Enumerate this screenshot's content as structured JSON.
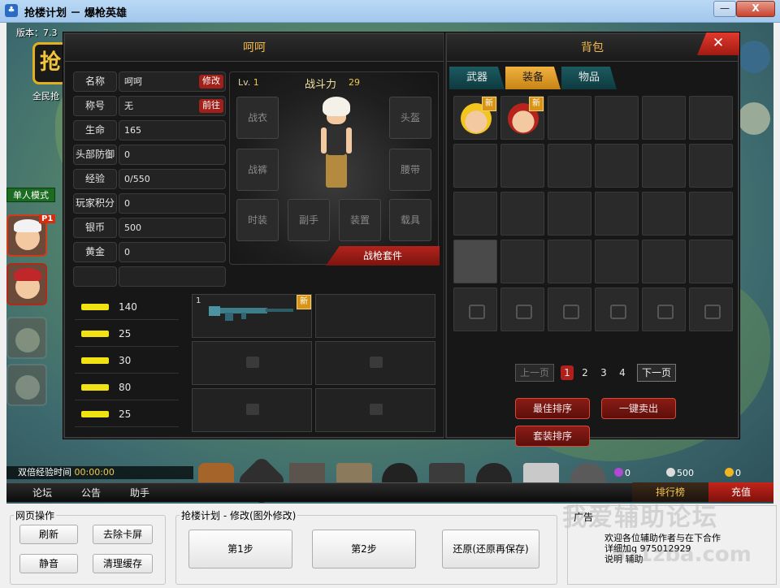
{
  "window": {
    "title": "抢楼计划 － 爆枪英雄",
    "minimize_label": "—",
    "close_label": "X"
  },
  "game": {
    "version": "版本：7.3",
    "logo_text": "抢",
    "logo_subtitle": "全民抢",
    "mode_label": "单人模式",
    "p1_badge": "P1"
  },
  "character_panel": {
    "title": "呵呵",
    "stats": [
      {
        "label": "名称",
        "value": "呵呵",
        "button": "修改"
      },
      {
        "label": "称号",
        "value": "无",
        "button": "前往"
      },
      {
        "label": "生命",
        "value": "165",
        "button": ""
      },
      {
        "label": "头部防御",
        "value": "0",
        "button": ""
      },
      {
        "label": "经验",
        "value": "0/550",
        "button": ""
      },
      {
        "label": "玩家积分",
        "value": "0",
        "button": ""
      },
      {
        "label": "银币",
        "value": "500",
        "button": ""
      },
      {
        "label": "黄金",
        "value": "0",
        "button": ""
      },
      {
        "label": "",
        "value": "",
        "button": ""
      }
    ],
    "level_prefix": "Lv.",
    "level": "1",
    "power_label": "战斗力",
    "power_value": "29",
    "equip_slots": {
      "armor": "战衣",
      "helmet": "头盔",
      "pants": "战裤",
      "belt": "腰带",
      "fashion": "时装",
      "offhand": "副手",
      "device": "装置",
      "vehicle": "载具"
    },
    "gun_suit_button": "战枪套件",
    "weapons": [
      {
        "count": "140"
      },
      {
        "count": "25"
      },
      {
        "count": "30"
      },
      {
        "count": "80"
      },
      {
        "count": "25"
      }
    ],
    "weapon_slot_index": "1",
    "new_badge": "新"
  },
  "bag_panel": {
    "title": "背包",
    "tabs": [
      {
        "label": "武器"
      },
      {
        "label": "装备"
      },
      {
        "label": "物品"
      }
    ],
    "new_badge": "新",
    "prev_page": "上一页",
    "next_page": "下一页",
    "pages": [
      "1",
      "2",
      "3",
      "4"
    ],
    "best_sort": "最佳排序",
    "sell_all": "一键卖出",
    "suit_sort": "套装排序"
  },
  "bottom_bar": {
    "double_exp_label": "双倍经验时间",
    "double_exp_time": "00:00:00",
    "nav": [
      "论坛",
      "公告",
      "助手"
    ],
    "rank": "排行榜",
    "charge": "充值",
    "currency": [
      {
        "value": "0",
        "color": "#b04ad4"
      },
      {
        "value": "500",
        "color": "#dcdcdc"
      },
      {
        "value": "0",
        "color": "#f1b521"
      }
    ]
  },
  "controls": {
    "web_ops_legend": "网页操作",
    "refresh": "刷新",
    "remove_lag": "去除卡屏",
    "mute": "静音",
    "clear_cache": "清理缓存",
    "plan_legend": "抢楼计划 - 修改(图外修改)",
    "step1": "第1步",
    "step2": "第2步",
    "restore": "还原(还原再保存)",
    "ad_title": "广告",
    "ad_lines": [
      "欢迎各位辅助作者与在下合作",
      "详细加q 975012929",
      "说明 辅助"
    ],
    "watermark": "我爱辅助论坛",
    "watermark2": "5z1zba.com"
  }
}
